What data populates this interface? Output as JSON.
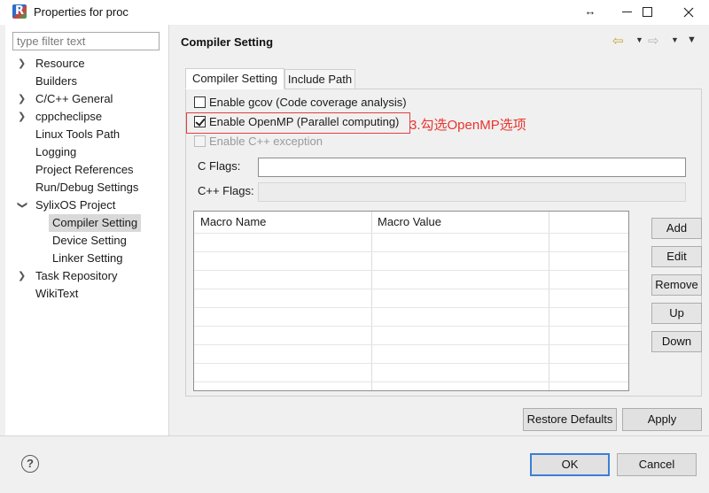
{
  "window": {
    "title": "Properties for proc",
    "app_icon_glyph": "R",
    "resize_glyph": "↔"
  },
  "sidebar": {
    "filter_placeholder": "type filter text",
    "items": [
      {
        "label": "Resource",
        "expandable": true
      },
      {
        "label": "Builders",
        "expandable": false
      },
      {
        "label": "C/C++ General",
        "expandable": true
      },
      {
        "label": "cppcheclipse",
        "expandable": true
      },
      {
        "label": "Linux Tools Path",
        "expandable": false
      },
      {
        "label": "Logging",
        "expandable": false
      },
      {
        "label": "Project References",
        "expandable": false
      },
      {
        "label": "Run/Debug Settings",
        "expandable": false
      },
      {
        "label": "SylixOS Project",
        "expandable": true,
        "expanded": true
      },
      {
        "label": "Compiler Setting",
        "child": true,
        "selected": true
      },
      {
        "label": "Device Setting",
        "child": true
      },
      {
        "label": "Linker Setting",
        "child": true
      },
      {
        "label": "Task Repository",
        "expandable": true
      },
      {
        "label": "WikiText",
        "expandable": false
      }
    ]
  },
  "page": {
    "title": "Compiler Setting",
    "nav_back_glyph": "⇦",
    "nav_forward_glyph": "⇨",
    "nav_dropdown_glyph": "▼",
    "tabs": [
      "Compiler Setting",
      "Include Path"
    ],
    "active_tab": 0,
    "options": [
      {
        "label": "Enable gcov (Code coverage analysis)",
        "checked": false,
        "enabled": true
      },
      {
        "label": "Enable OpenMP (Parallel computing)",
        "checked": true,
        "enabled": true
      },
      {
        "label": "Enable C++ exception",
        "checked": false,
        "enabled": false
      }
    ],
    "annotation": "3.勾选OpenMP选项",
    "c_flags": {
      "label": "C Flags:",
      "value": ""
    },
    "cpp_flags": {
      "label": "C++ Flags:",
      "value": ""
    },
    "macro_table": {
      "columns": [
        "Macro Name",
        "Macro Value",
        ""
      ],
      "rows": []
    },
    "table_buttons": [
      "Add",
      "Edit",
      "Remove",
      "Up",
      "Down"
    ],
    "restore_defaults": "Restore Defaults",
    "apply": "Apply"
  },
  "footer": {
    "help_glyph": "?",
    "ok": "OK",
    "cancel": "Cancel"
  },
  "colors": {
    "annotation": "#e8342e",
    "default_button_border": "#3c7fd6",
    "selection": "#d9d9d9"
  }
}
